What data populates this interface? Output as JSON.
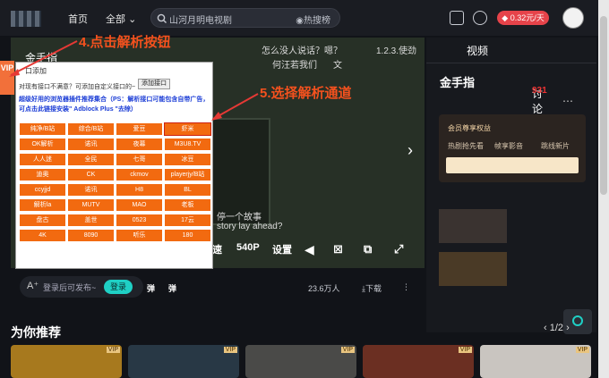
{
  "header": {
    "nav_home": "首页",
    "nav_all": "全部",
    "search_placeholder": "山河月明电视剧",
    "search_hot": "热搜榜",
    "vip_price": "0.32元/天"
  },
  "player": {
    "title": "金手指",
    "bullets": [
      "怎么没人说话？嗯？",
      "1.2.3.使劲",
      "何汪若我们",
      "文",
      "停一个故事",
      "story lay ahead?"
    ],
    "controls": [
      "速",
      "540P",
      "设置"
    ]
  },
  "vip_tag": "VIP",
  "popup": {
    "header": "口添加",
    "tip": "对现有接口不满意？可添加自定义接口的~",
    "add_button": "添加接口",
    "blue_text": "超级好用的浏览器插件推荐集合（PS：解析接口可能包含自带广告，可点击此链接安装\" Adblock Plus \"去除）",
    "channels": [
      "纯净/B站",
      "综合/B站",
      "爱豆",
      "虾米",
      "OK解析",
      "诺讯",
      "夜幕",
      "M3U8.TV",
      "人人迷",
      "全民",
      "七哥",
      "冰豆",
      "迪奥",
      "CK",
      "ckmov",
      "playerjy/B站",
      "ccyjjd",
      "诺讯",
      "H8",
      "BL",
      "解析la",
      "MUTV",
      "MAO",
      "老板",
      "盘古",
      "盖世",
      "0523",
      "17云",
      "4K",
      "8090",
      "听乐",
      "180"
    ],
    "selected_index": 3
  },
  "annotations": {
    "step4": "4.点击解析按钮",
    "step5": "5.选择解析通道"
  },
  "comment": {
    "placeholder": "登录后可发布~",
    "send": "登录",
    "danmaku": "弹",
    "heat": "23.6万人",
    "download": "下载"
  },
  "sidebar": {
    "tab_video": "视频",
    "tab_discuss": "讨论",
    "discuss_count": "931",
    "title": "金手指",
    "vip_title": "会员尊享权益",
    "features": [
      "热剧抢先看",
      "帧享影音",
      "跳线新片"
    ]
  },
  "recommend": {
    "title": "为你推荐",
    "page": "1",
    "total": "2",
    "vip": "VIP"
  }
}
